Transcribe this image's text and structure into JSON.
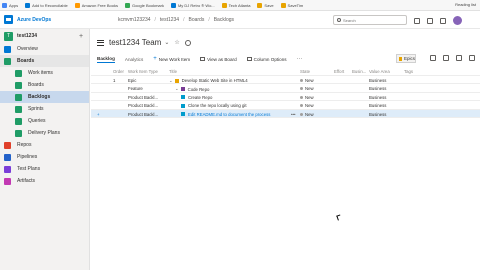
{
  "bookmarks": [
    {
      "label": "Apps",
      "color": "#4285f4"
    },
    {
      "label": "Add to Reconcilable",
      "color": "#0078d4"
    },
    {
      "label": "Amazon Free Books",
      "color": "#ff9900"
    },
    {
      "label": "Google Bookmark",
      "color": "#34a853"
    },
    {
      "label": "My DJ Retro ® Wo...",
      "color": "#0078d4"
    },
    {
      "label": "Tech Atlanta",
      "color": "#e8a400"
    },
    {
      "label": "Save",
      "color": "#e8a400"
    },
    {
      "label": "SaveTim",
      "color": "#e8a400"
    }
  ],
  "bookmarks_right": "Reading list",
  "brand": "Azure DevOps",
  "breadcrumb": [
    "kcmvm123234",
    "test1234",
    "Boards",
    "Backlogs"
  ],
  "search": {
    "placeholder": "Search"
  },
  "project": {
    "badge": "T",
    "name": "test1234"
  },
  "nav": [
    {
      "label": "Overview",
      "color": "#0078d4",
      "sub": false,
      "state": "normal"
    },
    {
      "label": "Boards",
      "color": "#1f9c66",
      "sub": false,
      "state": "section"
    },
    {
      "label": "Work items",
      "color": "#1f9c66",
      "sub": true,
      "state": "normal"
    },
    {
      "label": "Boards",
      "color": "#1f9c66",
      "sub": true,
      "state": "normal"
    },
    {
      "label": "Backlogs",
      "color": "#1f9c66",
      "sub": true,
      "state": "active"
    },
    {
      "label": "Sprints",
      "color": "#1f9c66",
      "sub": true,
      "state": "normal"
    },
    {
      "label": "Queries",
      "color": "#1f9c66",
      "sub": true,
      "state": "normal"
    },
    {
      "label": "Delivery Plans",
      "color": "#1f9c66",
      "sub": true,
      "state": "normal"
    },
    {
      "label": "Repos",
      "color": "#e0402a",
      "sub": false,
      "state": "normal"
    },
    {
      "label": "Pipelines",
      "color": "#2362c9",
      "sub": false,
      "state": "normal"
    },
    {
      "label": "Test Plans",
      "color": "#7a3ed8",
      "sub": false,
      "state": "normal"
    },
    {
      "label": "Artifacts",
      "color": "#c239b3",
      "sub": false,
      "state": "normal"
    }
  ],
  "team_title": "test1234 Team",
  "toolbar": {
    "tab_backlog": "Backlog",
    "tab_analytics": "Analytics",
    "new_work_item": "New Work Item",
    "view_as_board": "View as Board",
    "column_options": "Column Options",
    "level": "Epics"
  },
  "grid": {
    "headers": {
      "order": "Order",
      "type": "Work Item Type",
      "title": "Title",
      "state": "State",
      "effort": "Effort",
      "business": "Busin...",
      "area": "Value Area",
      "tags": "Tags"
    },
    "rows": [
      {
        "order": "1",
        "type": "Epic",
        "title": "Develop Static Web Site in HTML4",
        "caret": "⌄",
        "wi_color": "#e8a400",
        "indent": 0,
        "state": "New",
        "area": "Business",
        "selected": false,
        "link": false,
        "dots": ""
      },
      {
        "order": "",
        "type": "Feature",
        "title": "Code Repo",
        "caret": "⌄",
        "wi_color": "#773b93",
        "indent": 1,
        "state": "New",
        "area": "Business",
        "selected": false,
        "link": false,
        "dots": ""
      },
      {
        "order": "",
        "type": "Product Backl...",
        "title": "Create Repo",
        "caret": "",
        "wi_color": "#009ccc",
        "indent": 2,
        "state": "New",
        "area": "Business",
        "selected": false,
        "link": false,
        "dots": ""
      },
      {
        "order": "",
        "type": "Product Backl...",
        "title": "Clone the repo locally using git",
        "caret": "",
        "wi_color": "#009ccc",
        "indent": 2,
        "state": "New",
        "area": "Business",
        "selected": false,
        "link": false,
        "dots": ""
      },
      {
        "order": "",
        "type": "Product Backl...",
        "title": "Edit README.md to document the process",
        "caret": "",
        "wi_color": "#009ccc",
        "indent": 2,
        "state": "New",
        "area": "Business",
        "selected": true,
        "link": true,
        "dots": "•••"
      }
    ]
  }
}
